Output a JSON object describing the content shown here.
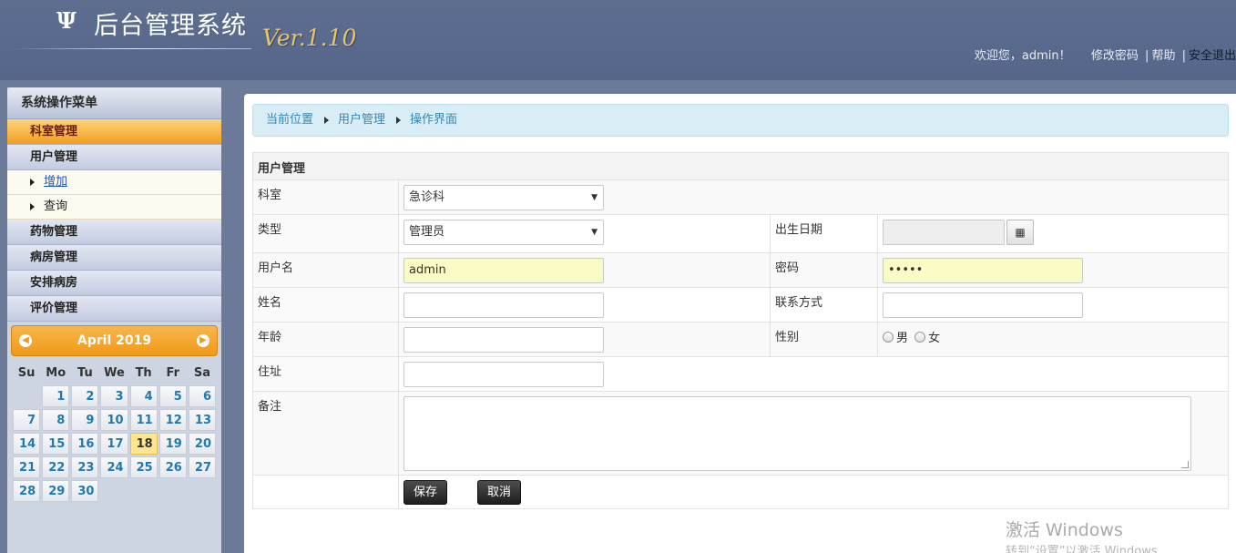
{
  "header": {
    "logo_glyph": "Ψ",
    "title": "后台管理系统",
    "version": "Ver.1.10",
    "welcome": "欢迎您，admin！",
    "change_password": "修改密码",
    "separator": "|",
    "help": "帮助",
    "logout": "安全退出"
  },
  "sidebar": {
    "heading": "系统操作菜单",
    "menu": {
      "dept": "科室管理",
      "user": "用户管理",
      "add": "增加",
      "query": "查询",
      "drug": "药物管理",
      "ward": "病房管理",
      "arrange": "安排病房",
      "review": "评价管理"
    }
  },
  "calendar": {
    "title": "April 2019",
    "weekdays": [
      "Su",
      "Mo",
      "Tu",
      "We",
      "Th",
      "Fr",
      "Sa"
    ],
    "weeks": [
      [
        "",
        "1",
        "2",
        "3",
        "4",
        "5",
        "6"
      ],
      [
        "7",
        "8",
        "9",
        "10",
        "11",
        "12",
        "13"
      ],
      [
        "14",
        "15",
        "16",
        "17",
        "18",
        "19",
        "20"
      ],
      [
        "21",
        "22",
        "23",
        "24",
        "25",
        "26",
        "27"
      ],
      [
        "28",
        "29",
        "30",
        "",
        "",
        "",
        ""
      ]
    ],
    "today": "18"
  },
  "breadcrumb": {
    "current": "当前位置",
    "section": "用户管理",
    "page": "操作界面"
  },
  "form": {
    "caption": "用户管理",
    "dept_label": "科室",
    "dept_value": "急诊科",
    "type_label": "类型",
    "type_value": "管理员",
    "birth_label": "出生日期",
    "birth_value": "",
    "username_label": "用户名",
    "username_value": "admin",
    "password_label": "密码",
    "password_value": "•••••",
    "name_label": "姓名",
    "name_value": "",
    "contact_label": "联系方式",
    "contact_value": "",
    "age_label": "年龄",
    "age_value": "",
    "gender_label": "性别",
    "gender_male": "男",
    "gender_female": "女",
    "address_label": "住址",
    "address_value": "",
    "remark_label": "备注",
    "remark_value": "",
    "save": "保存",
    "cancel": "取消"
  },
  "watermark": {
    "line1": "激活 Windows",
    "line2": "转到“设置”以激活 Windows"
  },
  "icons": {
    "calendar_button": "calendar-icon",
    "select_caret": "caret-down-icon",
    "nav_prev": "chevron-left-circle-icon",
    "nav_next": "chevron-right-circle-icon"
  },
  "colors": {
    "header_bg": "#5d6e8f",
    "active_menu": "#f1a021",
    "version_gold": "#e9c46a",
    "breadcrumb_bg": "#d9edf7",
    "input_highlight": "#fbfbc5"
  }
}
